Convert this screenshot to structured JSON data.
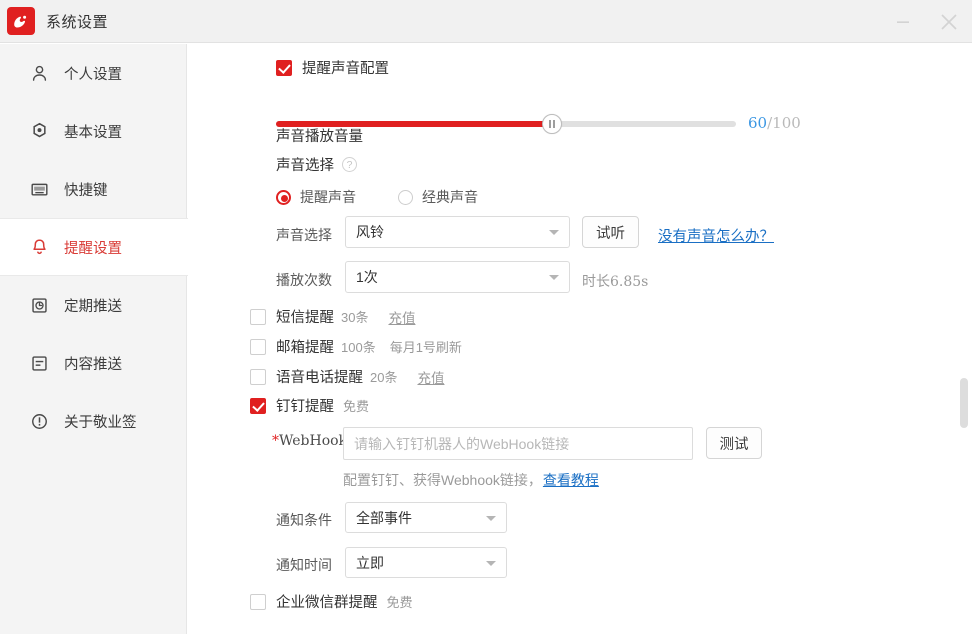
{
  "window": {
    "title": "系统设置",
    "logo_icon": "app-logo-icon",
    "minimize_label": "—",
    "close_label": "✕"
  },
  "sidebar": {
    "items": [
      {
        "label": "个人设置",
        "icon": "user-icon",
        "active": false
      },
      {
        "label": "基本设置",
        "icon": "gear-icon",
        "active": false
      },
      {
        "label": "快捷键",
        "icon": "keyboard-icon",
        "active": false
      },
      {
        "label": "提醒设置",
        "icon": "bell-icon",
        "active": true
      },
      {
        "label": "定期推送",
        "icon": "clock-document-icon",
        "active": false
      },
      {
        "label": "内容推送",
        "icon": "content-document-icon",
        "active": false
      },
      {
        "label": "关于敬业签",
        "icon": "info-icon",
        "active": false
      }
    ]
  },
  "main": {
    "sound_config": {
      "checkbox_label": "提醒声音配置",
      "checked": true
    },
    "volume": {
      "title": "声音播放音量",
      "value": "60",
      "separator": "/",
      "max": "100",
      "percent": 60
    },
    "sound_choice": {
      "title": "声音选择",
      "help_icon": "question-mark-icon",
      "radios": [
        {
          "label": "提醒声音",
          "selected": true
        },
        {
          "label": "经典声音",
          "selected": false
        }
      ]
    },
    "sound_select": {
      "label": "声音选择",
      "value": "风铃",
      "preview_button": "试听",
      "help_link": "没有声音怎么办？"
    },
    "play_count": {
      "label": "播放次数",
      "value": "1次",
      "duration": "时长6.85s"
    },
    "reminder_options": [
      {
        "label": "短信提醒",
        "quota": "30条",
        "action": "充值",
        "checked": false,
        "note": ""
      },
      {
        "label": "邮箱提醒",
        "quota": "100条",
        "action": "",
        "checked": false,
        "note": "每月1号刷新"
      },
      {
        "label": "语音电话提醒",
        "quota": "20条",
        "action": "充值",
        "checked": false,
        "note": ""
      },
      {
        "label": "钉钉提醒",
        "quota": "免费",
        "action": "",
        "checked": true,
        "note": ""
      }
    ],
    "webhook": {
      "required_mark": "*",
      "label": "WebHook",
      "placeholder": "请输入钉钉机器人的WebHook链接",
      "value": "",
      "test_button": "测试",
      "hint_prefix": "配置钉钉、获得Webhook链接，",
      "hint_link": "查看教程"
    },
    "notify_condition": {
      "label": "通知条件",
      "value": "全部事件"
    },
    "notify_time": {
      "label": "通知时间",
      "value": "立即"
    },
    "wecom_option": {
      "label": "企业微信群提醒",
      "quota": "免费",
      "checked": false
    }
  },
  "colors": {
    "accent_red": "#e02020",
    "active_red": "#d93b36",
    "link_blue": "#1a6fc4",
    "value_blue": "#3b97e3",
    "muted_grey": "#9a9a9a"
  }
}
